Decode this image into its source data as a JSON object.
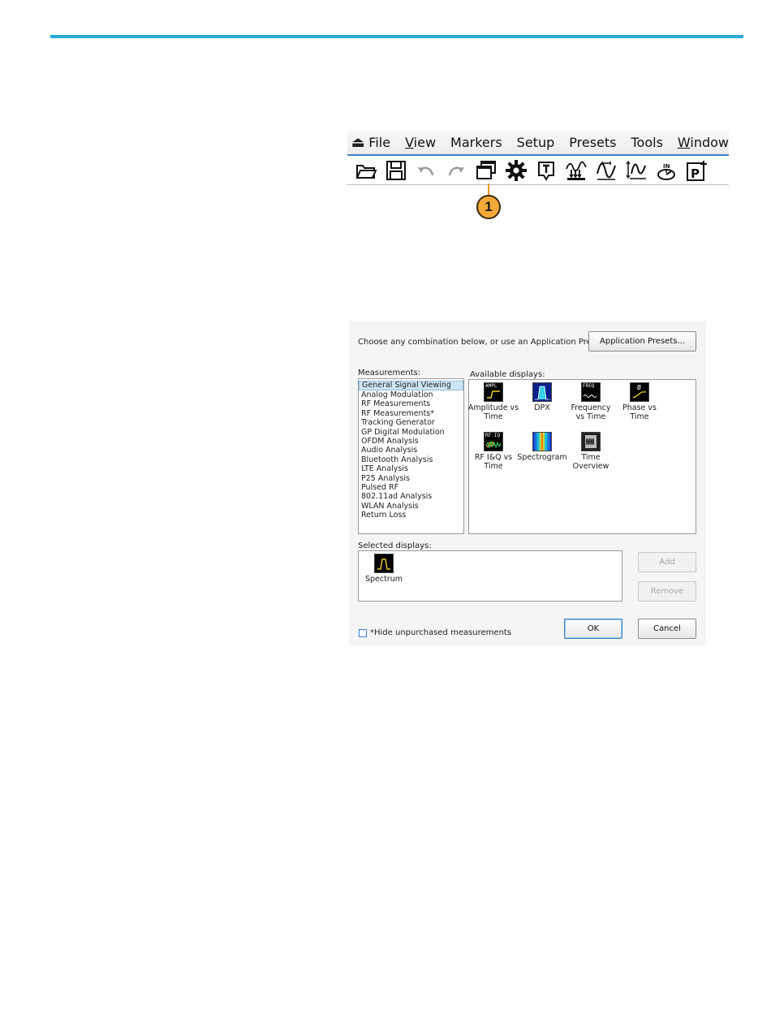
{
  "menubar": {
    "eject_icon": "eject-icon",
    "items": [
      {
        "label": "File"
      },
      {
        "pre": "",
        "u": "V",
        "post": "iew"
      },
      {
        "label": "Markers"
      },
      {
        "label": "Setup"
      },
      {
        "label": "Presets"
      },
      {
        "label": "Tools"
      },
      {
        "pre": "",
        "u": "W",
        "post": "indow"
      }
    ]
  },
  "toolbar": {
    "icons": [
      "open-folder-icon",
      "save-icon",
      "undo-icon",
      "redo-icon",
      "displays-icon",
      "settings-gear-icon",
      "trigger-icon",
      "acquire-icon",
      "analysis-icon",
      "amplitude-icon",
      "replay-icon",
      "presets-icon"
    ]
  },
  "callout": {
    "number": "1"
  },
  "dialog": {
    "intro": "Choose any combination below, or use an Application Preset.",
    "app_presets_button": "Application Presets...",
    "measurements_label": "Measurements:",
    "measurements": [
      "General Signal Viewing",
      "Analog Modulation",
      "RF Measurements",
      "RF Measurements*",
      "Tracking Generator",
      "GP Digital Modulation",
      "OFDM Analysis",
      "Audio Analysis",
      "Bluetooth Analysis",
      "LTE Analysis",
      "P25 Analysis",
      "Pulsed RF",
      "802.11ad Analysis",
      "WLAN Analysis",
      "Return Loss"
    ],
    "selected_measurement": "General Signal Viewing",
    "available_label": "Available displays:",
    "available": [
      {
        "icon": "ampl",
        "icon_text": "AMPL",
        "line1": "Amplitude vs",
        "line2": "Time"
      },
      {
        "icon": "dpx",
        "icon_text": "",
        "line1": "DPX",
        "line2": ""
      },
      {
        "icon": "freq",
        "icon_text": "FREQ",
        "line1": "Frequency",
        "line2": "vs Time"
      },
      {
        "icon": "phase",
        "icon_text": "Ø",
        "line1": "Phase vs",
        "line2": "Time"
      },
      {
        "icon": "rfiq",
        "icon_text": "RF IQ",
        "line1": "RF I&Q vs",
        "line2": "Time"
      },
      {
        "icon": "spectrogram",
        "icon_text": "",
        "line1": "Spectrogram",
        "line2": ""
      },
      {
        "icon": "timeov",
        "icon_text": "",
        "line1": "Time",
        "line2": "Overview"
      }
    ],
    "selected_label": "Selected displays:",
    "selected": [
      {
        "icon": "spectrum",
        "label": "Spectrum"
      }
    ],
    "add_button": "Add",
    "remove_button": "Remove",
    "hide_checkbox_label": "*Hide unpurchased measurements",
    "hide_checked": false,
    "ok_button": "OK",
    "cancel_button": "Cancel"
  }
}
